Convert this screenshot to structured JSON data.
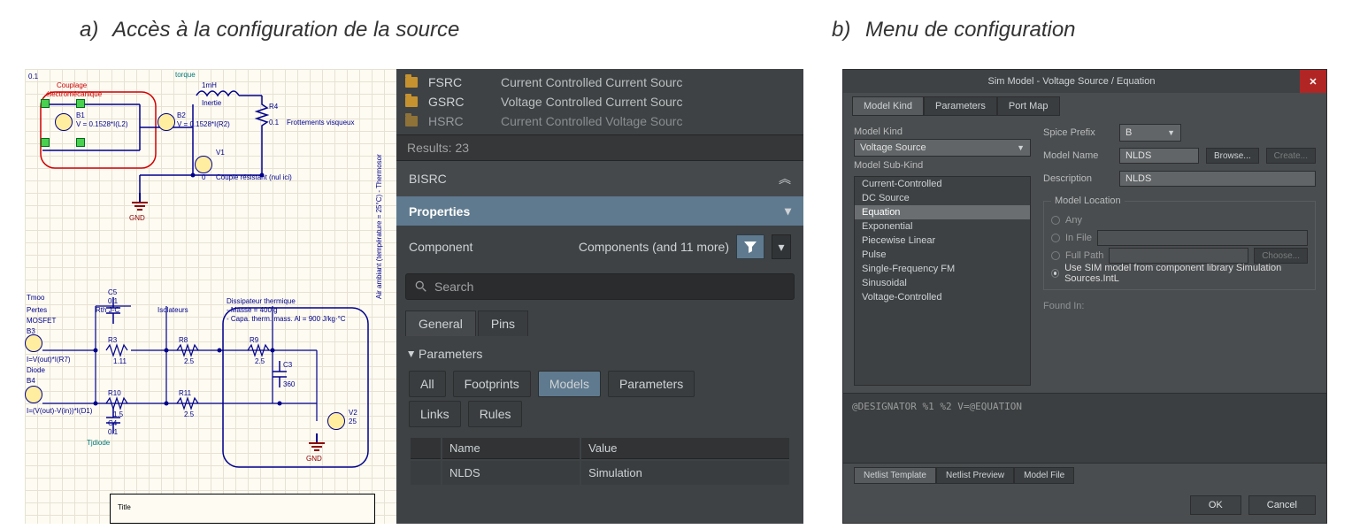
{
  "captions": {
    "a": {
      "letter": "a)",
      "text": "Accès à la configuration de la source"
    },
    "b": {
      "letter": "b)",
      "text": "Menu de configuration"
    }
  },
  "schematic": {
    "top_values": {
      "cap01_left": "0.1",
      "coupling_label": "Couplage",
      "electro_label": "électromécanique",
      "b1_name": "B1",
      "b1_value": "V = 0.1528*I(L2)",
      "b2_name": "B2",
      "b2_value": "V = 0.1528*I(R2)",
      "inertia_label": "Inertie",
      "inertia_value": "1mH",
      "r4_name": "R4",
      "r4_value": "0.1",
      "r4_label": "Frottements visqueux",
      "v1_name": "V1",
      "v1_value": "0",
      "v1_label": "Couple résistant (nul ici)",
      "torque_label": "torque",
      "gnd1": "GND"
    },
    "bottom_values": {
      "pertes_label": "Pertes",
      "mosfet_label": "MOSFET",
      "b3_name": "B3",
      "b3_expr": "I=V(out)*I(R7)",
      "diode_header": "Diode",
      "b4_name": "B4",
      "b4_expr": "I=(V(out)-V(in))*I(D1)",
      "rth_label": "Rth J-C",
      "r3_name": "R3",
      "r3_value": "1.11",
      "r10_name": "R10",
      "r10_value": "1.5",
      "c5_name": "C5",
      "c5_value": "0.1",
      "c4_name": "C4",
      "c4_value": "0.1",
      "tjdiode_label": "Tjdiode",
      "iso_label": "Isolateurs",
      "r8_name": "R8",
      "r8_value": "2.5",
      "r11_name": "R11",
      "r11_value": "2.5",
      "diss_label": "Dissipateur thermique",
      "diss_mass": "- Masse = 400 g",
      "diss_capa": "- Capa. therm. mass. Al = 900 J/kg·°C",
      "r9_name": "R9",
      "r9_value": "2.5",
      "c3_name": "C3",
      "c3_value": "360",
      "v2_name": "V2",
      "v2_value": "25",
      "gnd2": "GND",
      "air_label": "Air ambiant (température = 25°C) - Thermosor",
      "tmoo_label": "Tmoo",
      "title_placeholder": "Title"
    }
  },
  "panel": {
    "lib_items": [
      {
        "name": "FSRC",
        "desc": "Current Controlled Current Sourc"
      },
      {
        "name": "GSRC",
        "desc": "Voltage Controlled Current Sourc"
      },
      {
        "name": "HSRC",
        "desc": "Current Controlled Voltage Sourc"
      }
    ],
    "results": "Results: 23",
    "section": "BISRC",
    "properties_header": "Properties",
    "component_label": "Component",
    "component_scope": "Components (and 11 more)",
    "search_placeholder": "Search",
    "tabs": {
      "general": "General",
      "pins": "Pins"
    },
    "params_title": "Parameters",
    "pills": {
      "all": "All",
      "footprints": "Footprints",
      "models": "Models",
      "parameters": "Parameters",
      "links": "Links",
      "rules": "Rules"
    },
    "table": {
      "col_name": "Name",
      "col_value": "Value",
      "row_name": "NLDS",
      "row_value": "Simulation"
    }
  },
  "dialog": {
    "title": "Sim Model - Voltage Source / Equation",
    "tabs": {
      "model_kind": "Model Kind",
      "parameters": "Parameters",
      "port_map": "Port Map"
    },
    "model_kind_label": "Model Kind",
    "model_kind_value": "Voltage Source",
    "model_subkind_label": "Model Sub-Kind",
    "subkinds": [
      "Current-Controlled",
      "DC Source",
      "Equation",
      "Exponential",
      "Piecewise Linear",
      "Pulse",
      "Single-Frequency FM",
      "Sinusoidal",
      "Voltage-Controlled"
    ],
    "spice_prefix_label": "Spice Prefix",
    "spice_prefix_value": "B",
    "model_name_label": "Model Name",
    "model_name_value": "NLDS",
    "browse_btn": "Browse...",
    "create_btn": "Create...",
    "description_label": "Description",
    "description_value": "NLDS",
    "model_location_label": "Model Location",
    "loc_any": "Any",
    "loc_infile": "In File",
    "loc_fullpath": "Full Path",
    "choose_btn": "Choose...",
    "use_sim_label": "Use SIM model from component library Simulation Sources.IntL",
    "found_in_label": "Found In:",
    "netlist_text": "@DESIGNATOR %1 %2 V=@EQUATION",
    "bottom_tabs": {
      "template": "Netlist Template",
      "preview": "Netlist Preview",
      "modelfile": "Model File"
    },
    "ok": "OK",
    "cancel": "Cancel"
  }
}
